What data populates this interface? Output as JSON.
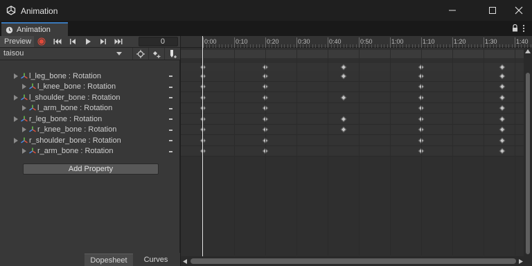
{
  "window": {
    "title": "Animation"
  },
  "tab": {
    "label": "Animation"
  },
  "toolbar": {
    "preview_label": "Preview",
    "frame_value": "0"
  },
  "clip": {
    "selected": "taisou"
  },
  "properties": [
    {
      "label": "l_leg_bone : Rotation",
      "child": false
    },
    {
      "label": "l_knee_bone : Rotation",
      "child": true
    },
    {
      "label": "l_shoulder_bone : Rotation",
      "child": false
    },
    {
      "label": "l_arm_bone : Rotation",
      "child": true
    },
    {
      "label": "r_leg_bone : Rotation",
      "child": false
    },
    {
      "label": "r_knee_bone : Rotation",
      "child": true
    },
    {
      "label": "r_shoulder_bone : Rotation",
      "child": false
    },
    {
      "label": "r_arm_bone : Rotation",
      "child": true
    }
  ],
  "add_property_label": "Add Property",
  "bottom_tabs": {
    "dopesheet": "Dopesheet",
    "curves": "Curves"
  },
  "timeline": {
    "ticks": [
      "0:00",
      "0:10",
      "0:20",
      "0:30",
      "0:40",
      "0:50",
      "1:00",
      "1:10",
      "1:20",
      "1:30",
      "1:40"
    ],
    "playhead_time": "0:00",
    "key_times_summary": [
      "0:00",
      "0:20",
      "0:45",
      "1:10",
      "1:36"
    ],
    "track_keys": [
      [
        "0:00",
        "0:20",
        "0:45",
        "1:10",
        "1:36"
      ],
      [
        "0:00",
        "0:20",
        "1:10",
        "1:36"
      ],
      [
        "0:00",
        "0:20",
        "0:45",
        "1:10",
        "1:36"
      ],
      [
        "0:00",
        "0:20",
        "1:10",
        "1:36"
      ],
      [
        "0:00",
        "0:20",
        "0:45",
        "1:10",
        "1:36"
      ],
      [
        "0:00",
        "0:20",
        "0:45",
        "1:10",
        "1:36"
      ],
      [
        "0:00",
        "0:20",
        "1:10",
        "1:36"
      ],
      [
        "0:00",
        "0:20",
        "1:10",
        "1:36"
      ]
    ]
  },
  "colors": {
    "accent": "#3a79bb",
    "record": "#e04a3a",
    "key": "#c4c4c4"
  }
}
